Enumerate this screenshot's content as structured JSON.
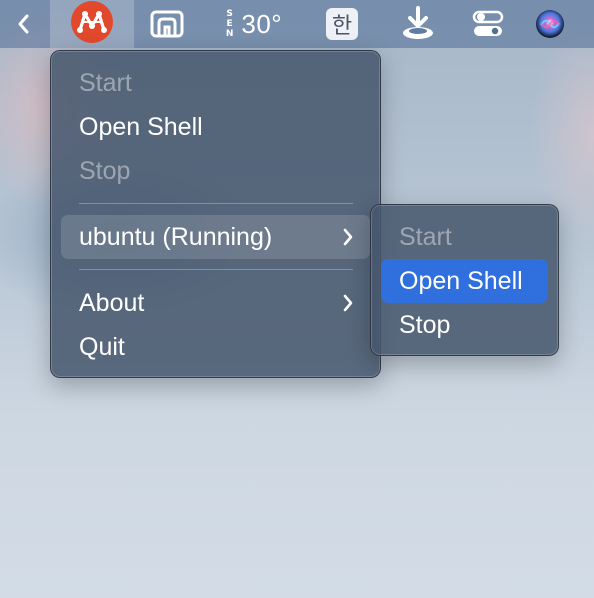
{
  "menubar": {
    "weather_temp": "30°",
    "compass_letters": [
      "S",
      "E",
      "N"
    ],
    "input_source": "한"
  },
  "main_menu": {
    "items": [
      {
        "label": "Start",
        "enabled": false
      },
      {
        "label": "Open Shell",
        "enabled": true
      },
      {
        "label": "Stop",
        "enabled": false
      },
      {
        "label": "ubuntu (Running)",
        "enabled": true,
        "submenu": true
      },
      {
        "label": "About",
        "enabled": true,
        "submenu": true
      },
      {
        "label": "Quit",
        "enabled": true
      }
    ]
  },
  "submenu": {
    "items": [
      {
        "label": "Start",
        "enabled": false
      },
      {
        "label": "Open Shell",
        "enabled": true,
        "selected": true
      },
      {
        "label": "Stop",
        "enabled": true
      }
    ]
  },
  "colors": {
    "app_icon": "#e2482c",
    "selection": "#2f6fde",
    "menu_bg": "#46566c"
  }
}
